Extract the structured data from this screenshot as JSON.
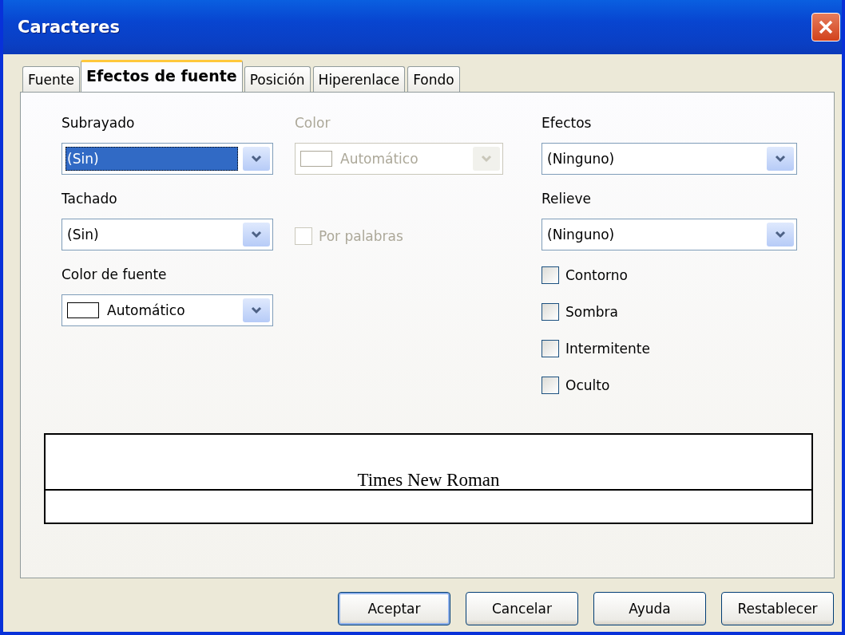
{
  "window": {
    "title": "Caracteres"
  },
  "tabs": [
    {
      "label": "Fuente",
      "selected": false
    },
    {
      "label": "Efectos de fuente",
      "selected": true
    },
    {
      "label": "Posición",
      "selected": false
    },
    {
      "label": "Hiperenlace",
      "selected": false
    },
    {
      "label": "Fondo",
      "selected": false
    }
  ],
  "columns": [
    [
      {
        "kind": "label",
        "text": "Subrayado",
        "disabled": false
      },
      {
        "kind": "dropdown",
        "value": "(Sin)",
        "focused": true,
        "disabled": false
      },
      {
        "kind": "label",
        "text": "Tachado",
        "disabled": false
      },
      {
        "kind": "dropdown",
        "value": "(Sin)",
        "focused": false,
        "disabled": false
      },
      {
        "kind": "label",
        "text": "Color de fuente",
        "disabled": false
      },
      {
        "kind": "color_dropdown",
        "value": "Automático",
        "focused": false,
        "disabled": false
      }
    ],
    [
      {
        "kind": "label",
        "text": "Color",
        "disabled": true
      },
      {
        "kind": "color_dropdown",
        "value": "Automático",
        "focused": false,
        "disabled": true
      },
      {
        "kind": "checkbox",
        "label": "Por palabras",
        "checked": false,
        "disabled": true
      }
    ],
    [
      {
        "kind": "label",
        "text": "Efectos",
        "disabled": false
      },
      {
        "kind": "dropdown",
        "value": "(Ninguno)",
        "focused": false,
        "disabled": false
      },
      {
        "kind": "label",
        "text": "Relieve",
        "disabled": false
      },
      {
        "kind": "dropdown",
        "value": "(Ninguno)",
        "focused": false,
        "disabled": false
      },
      {
        "kind": "checkbox",
        "label": "Contorno",
        "checked": false,
        "disabled": false
      },
      {
        "kind": "checkbox",
        "label": "Sombra",
        "checked": false,
        "disabled": false
      },
      {
        "kind": "checkbox",
        "label": "Intermitente",
        "checked": false,
        "disabled": false
      },
      {
        "kind": "checkbox",
        "label": "Oculto",
        "checked": false,
        "disabled": false
      }
    ]
  ],
  "preview": {
    "text": "Times New Roman"
  },
  "buttons": [
    {
      "label": "Aceptar",
      "default": true
    },
    {
      "label": "Cancelar",
      "default": false
    },
    {
      "label": "Ayuda",
      "default": false
    },
    {
      "label": "Restablecer",
      "default": false
    }
  ]
}
